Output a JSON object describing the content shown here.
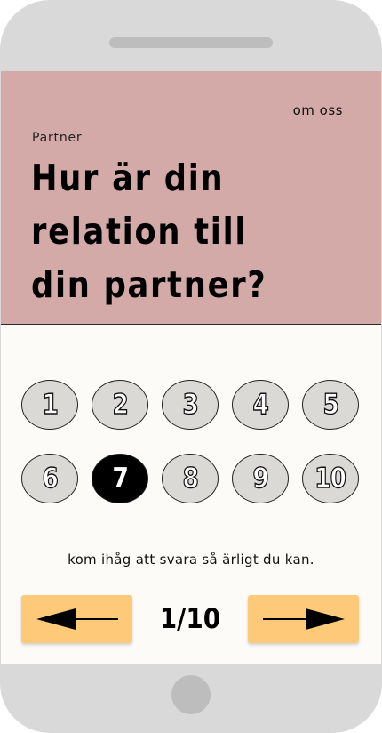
{
  "header": {
    "about_link": "om oss",
    "category": "Partner",
    "question": "Hur är din relation till din partner?"
  },
  "rating": {
    "options": [
      "1",
      "2",
      "3",
      "4",
      "5",
      "6",
      "7",
      "8",
      "9",
      "10"
    ],
    "selected": "7"
  },
  "hint": "kom ihåg att svara så ärligt du kan.",
  "navigation": {
    "progress": "1/10",
    "prev_icon": "arrow-left-icon",
    "next_icon": "arrow-right-icon"
  },
  "colors": {
    "header_bg": "#d3aaa8",
    "screen_bg": "#fcfbf7",
    "nav_button_bg": "#ffc97a",
    "option_bg": "#dbd9d5",
    "option_selected_bg": "#000000",
    "device_frame": "#d9d9d9"
  }
}
